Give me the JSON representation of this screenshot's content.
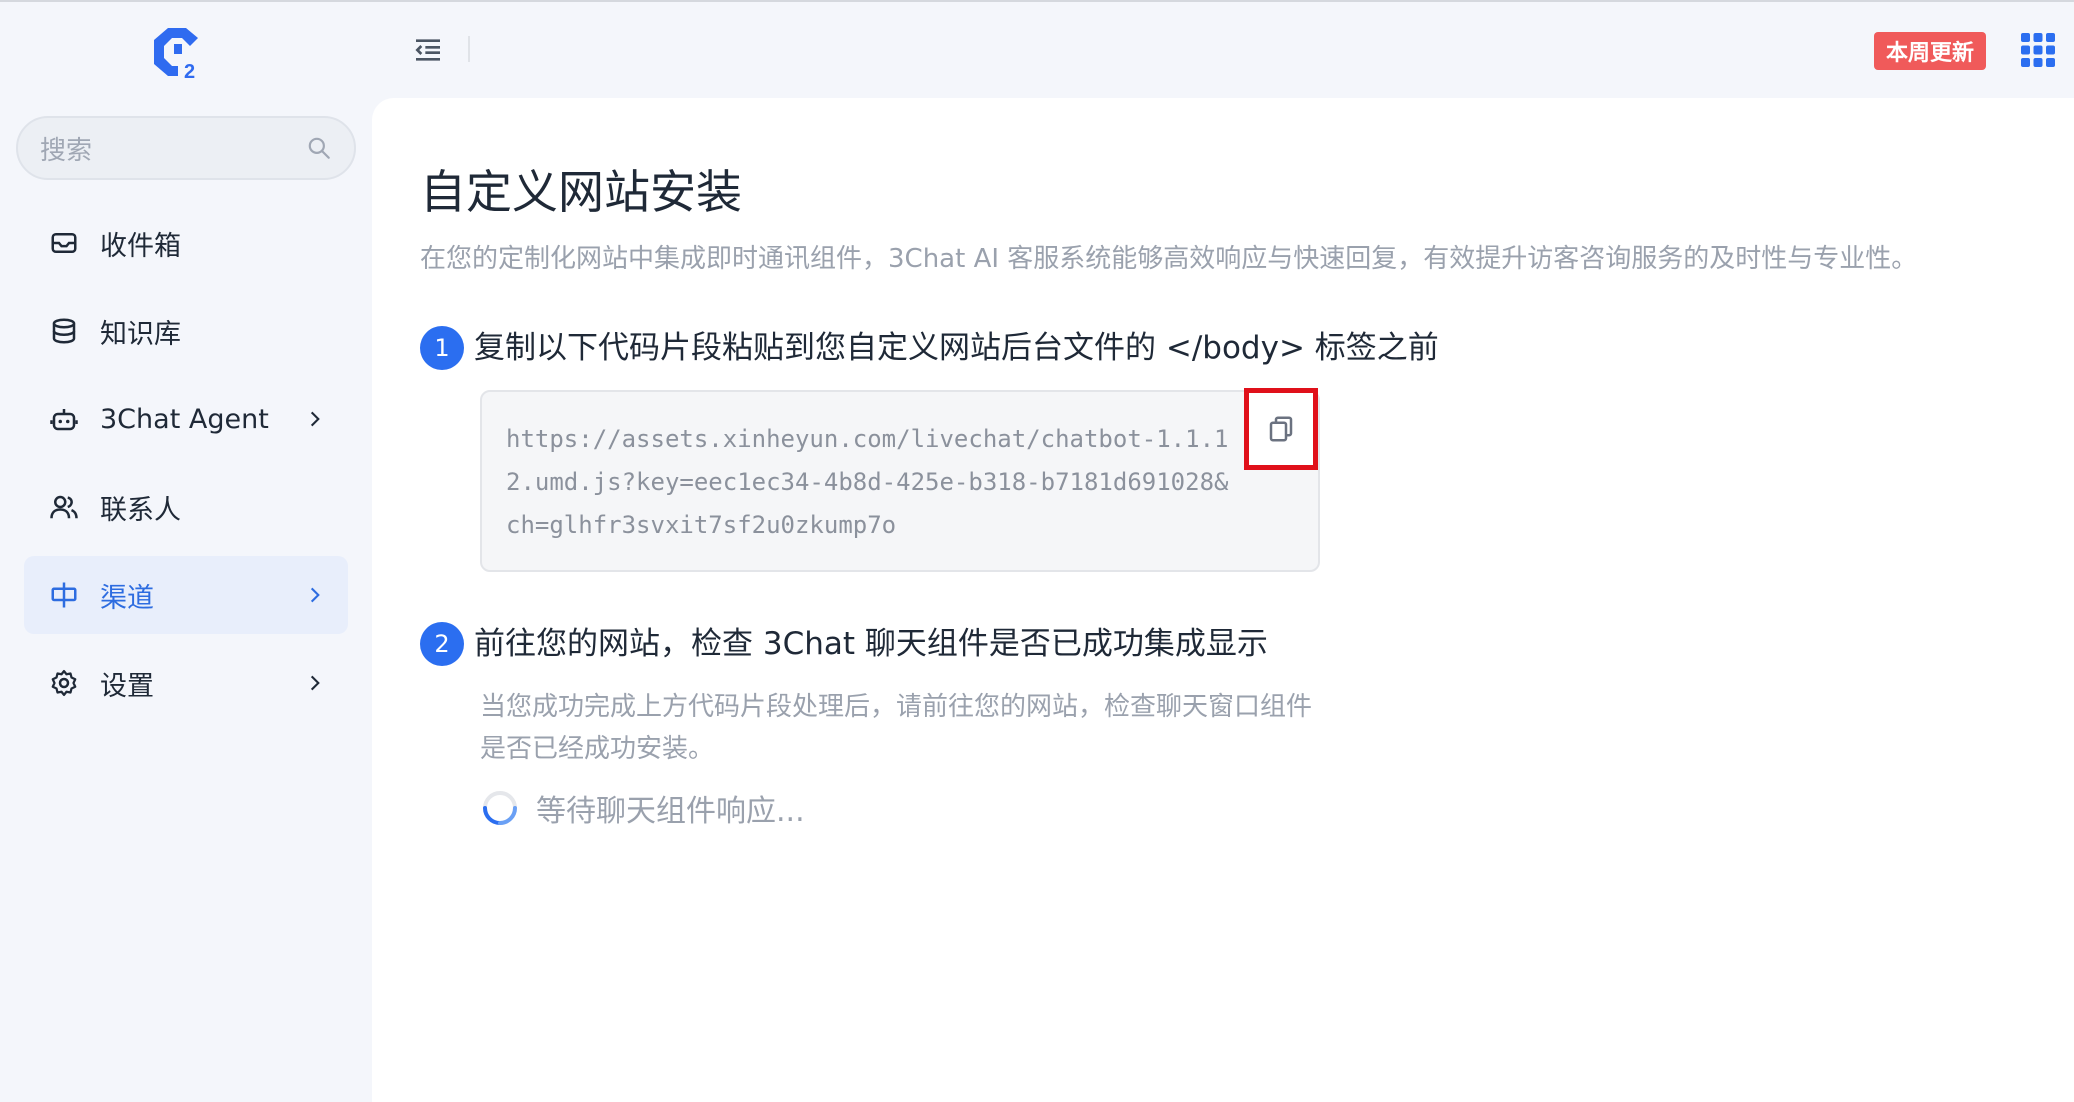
{
  "header": {
    "update_badge": "本周更新"
  },
  "sidebar": {
    "search": {
      "placeholder": "搜索"
    },
    "items": [
      {
        "label": "收件箱",
        "icon": "inbox-icon",
        "has_chevron": false,
        "active": false
      },
      {
        "label": "知识库",
        "icon": "database-icon",
        "has_chevron": false,
        "active": false
      },
      {
        "label": "3Chat Agent",
        "icon": "robot-icon",
        "has_chevron": true,
        "active": false
      },
      {
        "label": "联系人",
        "icon": "contacts-icon",
        "has_chevron": false,
        "active": false
      },
      {
        "label": "渠道",
        "icon": "channel-icon",
        "has_chevron": true,
        "active": true
      },
      {
        "label": "设置",
        "icon": "gear-icon",
        "has_chevron": true,
        "active": false
      }
    ]
  },
  "main": {
    "title": "自定义网站安装",
    "description": "在您的定制化网站中集成即时通讯组件，3Chat AI 客服系统能够高效响应与快速回复，有效提升访客咨询服务的及时性与专业性。",
    "steps": [
      {
        "number": "1",
        "title": "复制以下代码片段粘贴到您自定义网站后台文件的 </body> 标签之前",
        "code": "https://assets.xinheyun.com/livechat/chatbot-1.1.12.umd.js?key=eec1ec34-4b8d-425e-b318-b7181d691028&ch=glhfr3svxit7sf2u0zkump7o"
      },
      {
        "number": "2",
        "title": "前往您的网站，检查 3Chat 聊天组件是否已成功集成显示",
        "description": "当您成功完成上方代码片段处理后，请前往您的网站，检查聊天窗口组件是否已经成功安装。",
        "waiting_text": "等待聊天组件响应..."
      }
    ]
  },
  "colors": {
    "accent": "#2b6ef0",
    "active_bg": "#e8eefb",
    "badge": "#f05a5a",
    "highlight": "#e0101a"
  }
}
